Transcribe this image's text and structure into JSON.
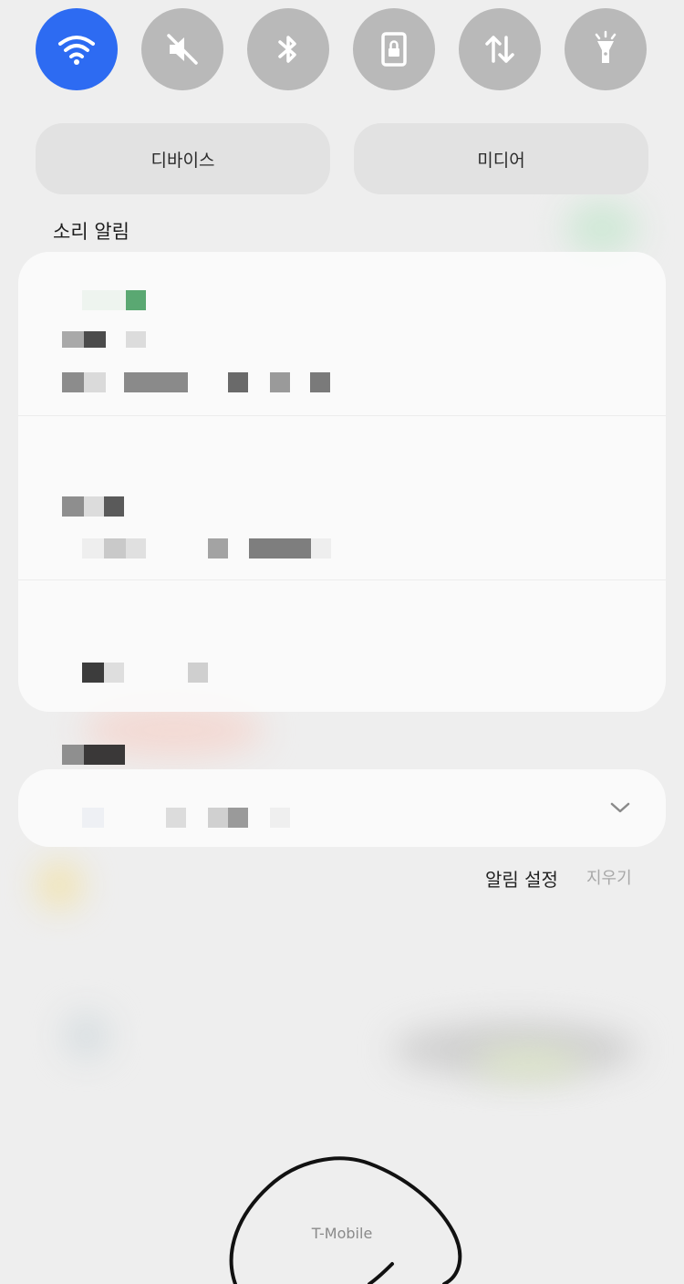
{
  "quick_toggles": [
    {
      "icon": "wifi-icon",
      "active": true
    },
    {
      "icon": "mute-icon",
      "active": false
    },
    {
      "icon": "bluetooth-icon",
      "active": false
    },
    {
      "icon": "rotation-lock-icon",
      "active": false
    },
    {
      "icon": "mobile-data-icon",
      "active": false
    },
    {
      "icon": "flashlight-icon",
      "active": false
    }
  ],
  "output": {
    "devices_label": "디바이스",
    "media_label": "미디어"
  },
  "notifications": {
    "section_title": "소리 알림",
    "settings_label": "알림 설정",
    "clear_label": "지우기"
  },
  "status": {
    "carrier": "T-Mobile"
  },
  "colors": {
    "accent": "#2d6bf2",
    "toggle_inactive": "#b9b9b9",
    "background": "#eeeeee"
  }
}
